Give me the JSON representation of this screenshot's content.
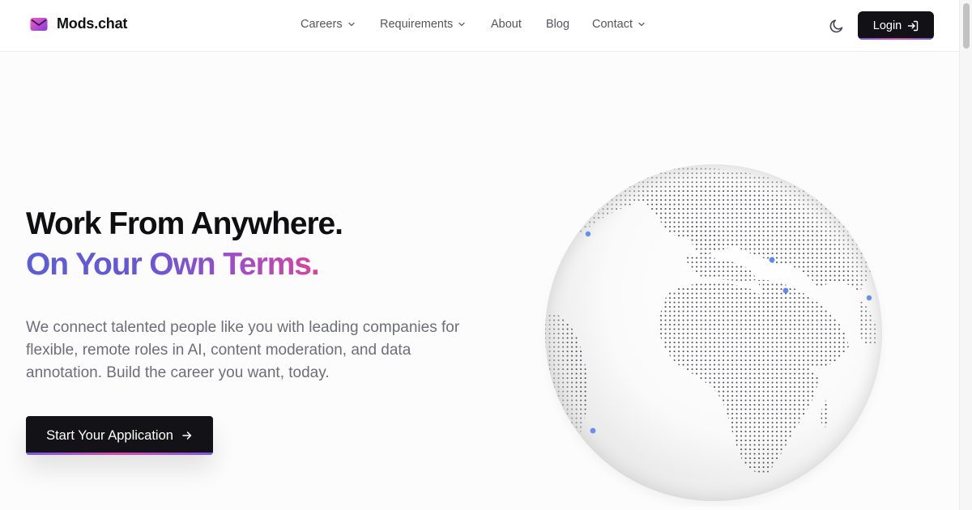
{
  "brand": {
    "name": "Mods.chat",
    "logo_icon": "envelope-icon",
    "accent": "#d84fb8"
  },
  "nav": {
    "items": [
      {
        "label": "Careers",
        "has_dropdown": true
      },
      {
        "label": "Requirements",
        "has_dropdown": true
      },
      {
        "label": "About",
        "has_dropdown": false
      },
      {
        "label": "Blog",
        "has_dropdown": false
      },
      {
        "label": "Contact",
        "has_dropdown": true
      }
    ]
  },
  "header_actions": {
    "theme_toggle_icon": "moon-icon",
    "login_label": "Login",
    "login_icon": "login-arrow-icon"
  },
  "hero": {
    "title_line1": "Work From Anywhere.",
    "title_line2": "On Your Own Terms.",
    "description": "We connect talented people like you with leading companies for flexible, remote roles in AI, content moderation, and data annotation. Build the career you want, today.",
    "cta_label": "Start Your Application",
    "cta_icon": "arrow-right-icon",
    "gradient_colors": [
      "#5b5fd6",
      "#a54cc4",
      "#d8449e"
    ]
  },
  "globe": {
    "icon": "dotted-globe-illustration",
    "marker_color": "#4f7cf0"
  }
}
